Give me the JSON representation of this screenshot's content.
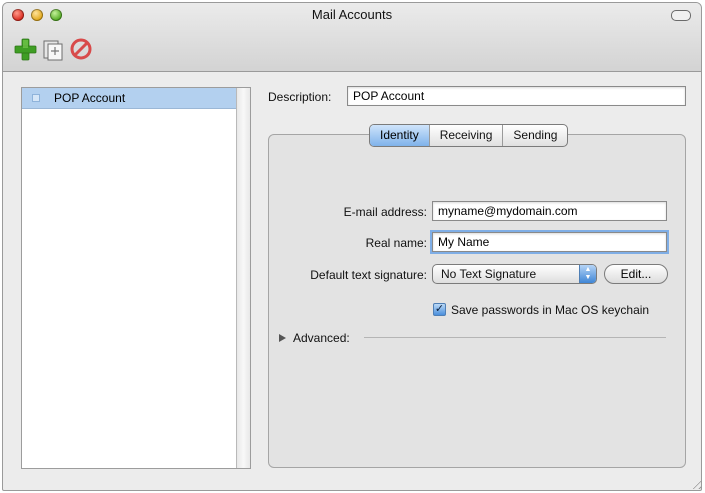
{
  "window": {
    "title": "Mail Accounts"
  },
  "toolbar": {
    "add_icon": "plus-icon",
    "duplicate_icon": "duplicate-icon",
    "delete_icon": "prohibited-icon"
  },
  "accounts": {
    "items": [
      {
        "label": "POP Account",
        "selected": true
      }
    ]
  },
  "description": {
    "label": "Description:",
    "value": "POP Account"
  },
  "tabs": [
    {
      "label": "Identity",
      "active": true
    },
    {
      "label": "Receiving",
      "active": false
    },
    {
      "label": "Sending",
      "active": false
    }
  ],
  "identity": {
    "email_label": "E-mail address:",
    "email_value": "myname@mydomain.com",
    "name_label": "Real name:",
    "name_value": "My Name",
    "signature_label": "Default text signature:",
    "signature_value": "No Text Signature",
    "edit_label": "Edit...",
    "keychain_label": "Save passwords in Mac OS keychain",
    "keychain_checked": true,
    "advanced_label": "Advanced:"
  },
  "colors": {
    "selection": "#b3d0ef",
    "accent": "#4a8fdc",
    "window_bg": "#ececec"
  }
}
